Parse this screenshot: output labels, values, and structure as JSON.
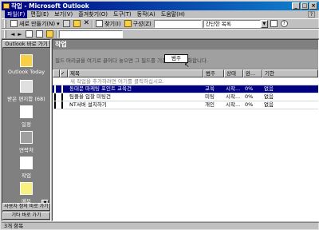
{
  "window": {
    "title": "작업 - Microsoft Outlook"
  },
  "menu": [
    "파일(F)",
    "편집(E)",
    "보기(V)",
    "즐겨찾기(O)",
    "도구(T)",
    "동작(A)",
    "도움말(H)"
  ],
  "toolbar1": {
    "new_label": "새로 만들기(N)",
    "find_label": "찾기(I)",
    "organize_label": "구성(Z)",
    "find_box": "",
    "view_combo": "간단한 목록"
  },
  "toolbar2": {
    "address": ""
  },
  "outlook_bar": {
    "header": "Outlook 바로 가기",
    "items": [
      "Outlook Today",
      "받은 편지함 (68)",
      "일정",
      "연락처",
      "작업",
      "메모"
    ],
    "footer1": "사용자 정의 바로 가기",
    "footer2": "기타 바로 가기"
  },
  "folder_banner": "작업",
  "group_hint": "필드 머리글을 여기로 끌어다 놓으면 그 필드를 기준으로 그룹화합니다.",
  "group_field": "범주",
  "columns": {
    "subject": "제목",
    "category": "범주",
    "status": "상태",
    "percent": "완...",
    "due": "기한"
  },
  "new_item_prompt": "새 작업을 추가하려면 여기를 클릭하십시오.",
  "tasks": [
    {
      "subject": "동대문 마케팅 포인트 교육건",
      "category": "교육",
      "status": "시작...",
      "percent": "0%",
      "due": "없음",
      "selected": true
    },
    {
      "subject": "팀플을 입찰 미팅건",
      "category": "미팅",
      "status": "시작...",
      "percent": "0%",
      "due": "없음",
      "selected": false
    },
    {
      "subject": "NT서버 설치하기",
      "category": "개인",
      "status": "시작...",
      "percent": "0%",
      "due": "없음",
      "selected": false
    }
  ],
  "status_bar": "3개 항목"
}
